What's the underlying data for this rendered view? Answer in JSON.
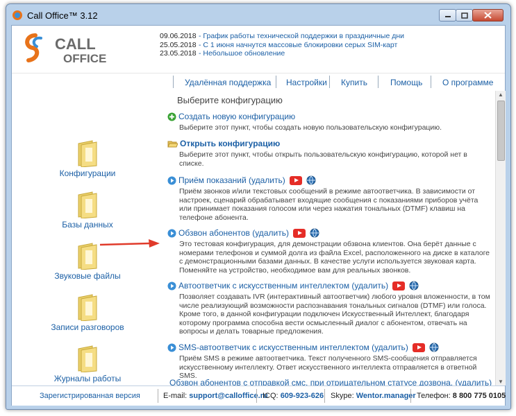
{
  "window": {
    "title": "Call Office™ 3.12"
  },
  "logo": {
    "line1": "CALL",
    "line2": "OFFICE",
    "brand_color": "#e8731a",
    "text_color": "#6a6a6a"
  },
  "news": [
    {
      "date": "09.06.2018",
      "text": "- График работы технической поддержки в праздничные дни"
    },
    {
      "date": "25.05.2018",
      "text": "- С 1 июня начнутся массовые блокировки серых SIM-карт"
    },
    {
      "date": "23.05.2018",
      "text": "- Небольшое обновление"
    }
  ],
  "menu": {
    "remote": "Удалённая поддержка",
    "settings": "Настройки",
    "buy": "Купить",
    "help": "Помощь",
    "about": "О программе"
  },
  "sidebar": {
    "items": [
      {
        "label": "Конфигурации"
      },
      {
        "label": "Базы данных"
      },
      {
        "label": "Звуковые файлы"
      },
      {
        "label": "Записи разговоров"
      },
      {
        "label": "Журналы работы"
      }
    ]
  },
  "content": {
    "heading": "Выберите конфигурацию",
    "create": {
      "title": "Создать новую конфигурацию",
      "desc": "Выберите этот пункт, чтобы создать новую пользовательскую конфигурацию."
    },
    "open": {
      "title": "Открыть конфигурацию",
      "desc": "Выберите этот пункт, чтобы открыть пользовательскую конфигурацию, которой нет в списке."
    },
    "configs": [
      {
        "title": "Приём показаний (удалить)",
        "desc": "Приём звонков и/или текстовых сообщений в режиме автоответчика. В зависимости от настроек, сценарий обрабатывает входящие сообщения с показаниями приборов учёта или принимает показания голосом или через нажатия тональных (DTMF) клавиш на телефоне абонента."
      },
      {
        "title": "Обзвон абонентов (удалить)",
        "desc": "Это тестовая конфигурация, для демонстрации обзвона клиентов. Она берёт данные с номерами телефонов и суммой долга из файла Excel, расположенного на диске в каталоге с демонстрационными базами данных. В качестве услуги используется звуковая карта. Поменяйте на устройство, необходимое вам для реальных звонков."
      },
      {
        "title": "Автоответчик с искусственным интеллектом (удалить)",
        "desc": "Позволяет создавать IVR (интерактивный автоответчик) любого уровня вложенности, в том числе реализующий возможности распознавания тональных сигналов (DTMF) или голоса. Кроме того, в данной конфигурации подключен Искусственный Интеллект, благодаря которому программа способна вести осмысленный диалог с абонентом, отвечать на вопросы и делать товарные предложения."
      },
      {
        "title": "SMS-автоответчик с искусственным интеллектом (удалить)",
        "desc": "Приём SMS в режиме автоответчика. Текст полученного SMS-сообщения отправляется искусственному интеллекту. Ответ искусственного интеллекта отправляется в ответной SMS."
      },
      {
        "title": "Обзвон абонентов с отправкой смс, при отрицательном статусе дозвона. (удалить)",
        "desc": ""
      }
    ]
  },
  "status": {
    "registered": "Зарегистрированная версия",
    "email_label": "E-mail:",
    "email": "support@calloffice.ru",
    "icq_label": "ICQ:",
    "icq": "609-923-626",
    "skype_label": "Skype:",
    "skype": "Wentor.manager",
    "phone_label": "Телефон:",
    "phone": "8 800 775 0105"
  },
  "colors": {
    "link": "#1b5fa5",
    "accent_arrow": "#e03a2a",
    "youtube": "#e52d27",
    "frame": "#b9d1ea"
  }
}
